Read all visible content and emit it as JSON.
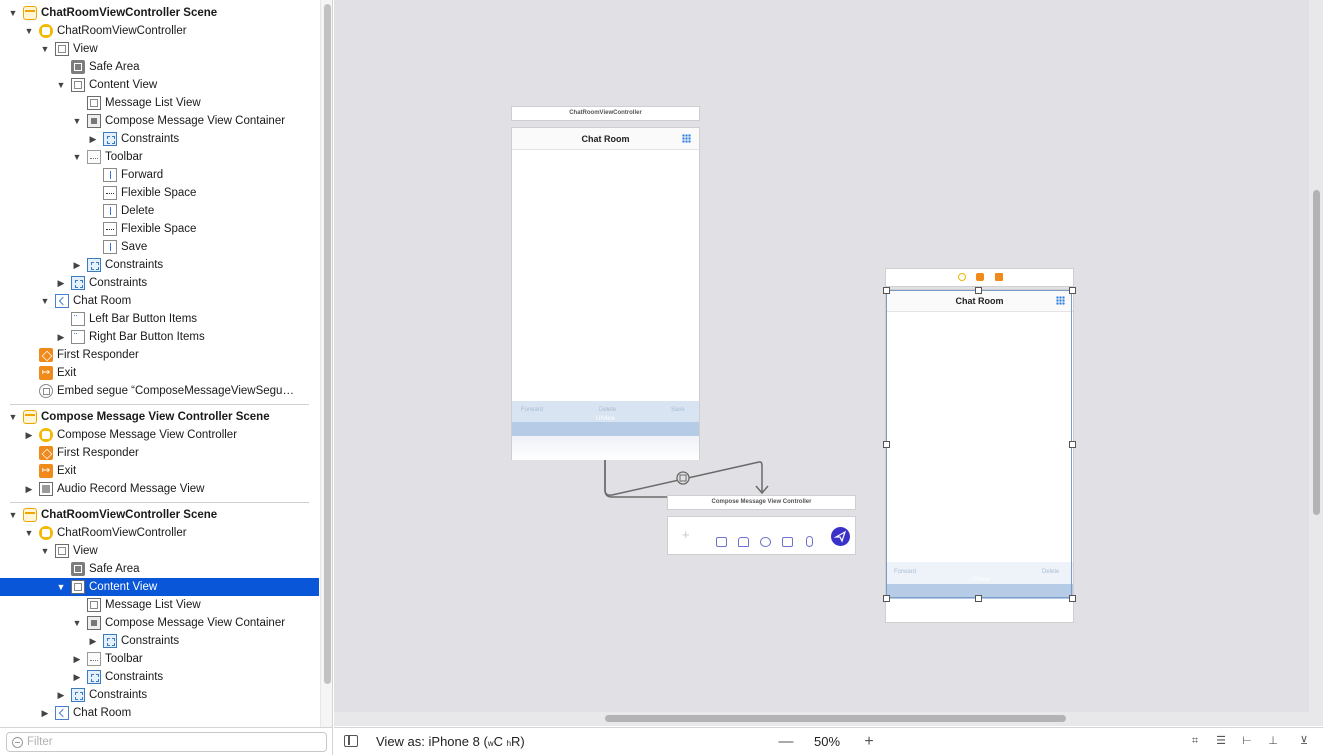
{
  "outline": {
    "rows": [
      {
        "label": "ChatRoomViewController Scene",
        "icon": "scene-icon",
        "level": 0,
        "disclosure": "open",
        "scene": true
      },
      {
        "label": "ChatRoomViewController",
        "icon": "view-controller-icon",
        "level": 1,
        "disclosure": "open"
      },
      {
        "label": "View",
        "icon": "view-icon",
        "level": 2,
        "disclosure": "open"
      },
      {
        "label": "Safe Area",
        "icon": "safe-area-icon",
        "level": 3,
        "disclosure": "none"
      },
      {
        "label": "Content View",
        "icon": "view-icon",
        "level": 3,
        "disclosure": "open"
      },
      {
        "label": "Message List View",
        "icon": "view-icon",
        "level": 4,
        "disclosure": "none"
      },
      {
        "label": "Compose Message View Container",
        "icon": "container-view-icon",
        "level": 4,
        "disclosure": "open"
      },
      {
        "label": "Constraints",
        "icon": "constraints-icon",
        "level": 5,
        "disclosure": "closed"
      },
      {
        "label": "Toolbar",
        "icon": "toolbar-icon",
        "level": 4,
        "disclosure": "open"
      },
      {
        "label": "Forward",
        "icon": "bar-button-item-icon",
        "level": 5,
        "disclosure": "none"
      },
      {
        "label": "Flexible Space",
        "icon": "flexible-space-icon",
        "level": 5,
        "disclosure": "none"
      },
      {
        "label": "Delete",
        "icon": "bar-button-item-icon",
        "level": 5,
        "disclosure": "none"
      },
      {
        "label": "Flexible Space",
        "icon": "flexible-space-icon",
        "level": 5,
        "disclosure": "none"
      },
      {
        "label": "Save",
        "icon": "bar-button-item-icon",
        "level": 5,
        "disclosure": "none"
      },
      {
        "label": "Constraints",
        "icon": "constraints-icon",
        "level": 4,
        "disclosure": "closed"
      },
      {
        "label": "Constraints",
        "icon": "constraints-icon",
        "level": 3,
        "disclosure": "closed"
      },
      {
        "label": "Chat Room",
        "icon": "navigation-item-icon",
        "level": 2,
        "disclosure": "open"
      },
      {
        "label": "Left Bar Button Items",
        "icon": "bar-button-items-icon",
        "level": 3,
        "disclosure": "none"
      },
      {
        "label": "Right Bar Button Items",
        "icon": "bar-button-items-icon",
        "level": 3,
        "disclosure": "closed"
      },
      {
        "label": "First Responder",
        "icon": "first-responder-icon",
        "level": 1,
        "disclosure": "none"
      },
      {
        "label": "Exit",
        "icon": "exit-icon",
        "level": 1,
        "disclosure": "none"
      },
      {
        "label": "Embed segue “ComposeMessageViewSegu…",
        "icon": "segue-icon",
        "level": 1,
        "disclosure": "none"
      },
      {
        "separator": true
      },
      {
        "label": "Compose Message View Controller Scene",
        "icon": "scene-icon",
        "level": 0,
        "disclosure": "open",
        "scene": true
      },
      {
        "label": "Compose Message View Controller",
        "icon": "view-controller-icon",
        "level": 1,
        "disclosure": "closed"
      },
      {
        "label": "First Responder",
        "icon": "first-responder-icon",
        "level": 1,
        "disclosure": "none"
      },
      {
        "label": "Exit",
        "icon": "exit-icon",
        "level": 1,
        "disclosure": "none"
      },
      {
        "label": "Audio Record Message View",
        "icon": "custom-view-icon",
        "level": 1,
        "disclosure": "closed"
      },
      {
        "separator": true
      },
      {
        "label": "ChatRoomViewController Scene",
        "icon": "scene-icon",
        "level": 0,
        "disclosure": "open",
        "scene": true
      },
      {
        "label": "ChatRoomViewController",
        "icon": "view-controller-icon",
        "level": 1,
        "disclosure": "open"
      },
      {
        "label": "View",
        "icon": "view-icon",
        "level": 2,
        "disclosure": "open"
      },
      {
        "label": "Safe Area",
        "icon": "safe-area-icon",
        "level": 3,
        "disclosure": "none"
      },
      {
        "label": "Content View",
        "icon": "view-icon",
        "level": 3,
        "disclosure": "open",
        "selected": true
      },
      {
        "label": "Message List View",
        "icon": "view-icon",
        "level": 4,
        "disclosure": "none"
      },
      {
        "label": "Compose Message View Container",
        "icon": "container-view-icon",
        "level": 4,
        "disclosure": "open"
      },
      {
        "label": "Constraints",
        "icon": "constraints-icon",
        "level": 5,
        "disclosure": "closed"
      },
      {
        "label": "Toolbar",
        "icon": "toolbar-icon",
        "level": 4,
        "disclosure": "closed"
      },
      {
        "label": "Constraints",
        "icon": "constraints-icon",
        "level": 4,
        "disclosure": "closed"
      },
      {
        "label": "Constraints",
        "icon": "constraints-icon",
        "level": 3,
        "disclosure": "closed"
      },
      {
        "label": "Chat Room",
        "icon": "navigation-item-icon",
        "level": 2,
        "disclosure": "closed"
      }
    ],
    "filter": {
      "placeholder": "Filter",
      "value": ""
    }
  },
  "canvas": {
    "scene1": {
      "scene_title": "ChatRoomViewController",
      "nav_title": "Chat Room",
      "toolbar_items": [
        "Forward",
        "Delete",
        "Save"
      ],
      "container_label": "UIView"
    },
    "compose": {
      "scene_title": "Compose Message View Controller",
      "plus_label": "+"
    },
    "scene2": {
      "nav_title": "Chat Room",
      "toolbar_items": [
        "Forward",
        "Delete"
      ],
      "container_label": "UIView"
    }
  },
  "bottom_bar": {
    "view_as_prefix": "View as: iPhone 8 (",
    "size_class_w": "w",
    "size_class_w_value": "C",
    "size_class_h": "h",
    "size_class_h_value": "R)",
    "zoom_out": "—",
    "zoom_level": "50%",
    "zoom_in": "+"
  },
  "colors": {
    "selection": "#0a56d9",
    "canvas_background": "#e1e1e5",
    "scene_icon": "#f0a500",
    "first_responder": "#f08a1a",
    "send_button": "#3a32c8",
    "toolbar_tint": "#d8e4f2"
  }
}
